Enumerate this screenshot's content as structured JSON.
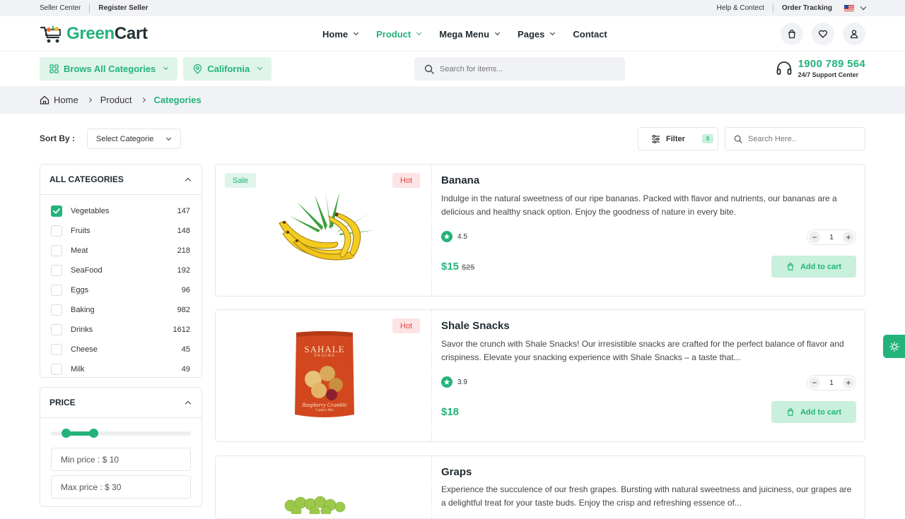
{
  "topbar": {
    "seller_center": "Seller Center",
    "register_seller": "Register Seller",
    "help_contact": "Help & Contect",
    "order_tracking": "Order Tracking",
    "language_flag": "us-flag-icon"
  },
  "brand": {
    "logo_green": "Green",
    "logo_dark": "Cart",
    "color": "#23b37a"
  },
  "nav": {
    "items": [
      {
        "label": "Home",
        "has_dropdown": true,
        "active": false
      },
      {
        "label": "Product",
        "has_dropdown": true,
        "active": true
      },
      {
        "label": "Mega Menu",
        "has_dropdown": true,
        "active": false
      },
      {
        "label": "Pages",
        "has_dropdown": true,
        "active": false
      },
      {
        "label": "Contact",
        "has_dropdown": false,
        "active": false
      }
    ]
  },
  "subbar": {
    "categories_btn": "Brows All Categories",
    "location_btn": "California",
    "search_placeholder": "Search for items...",
    "support_phone": "1900 789 564",
    "support_label": "24/7 Support Center"
  },
  "breadcrumb": {
    "items": [
      "Home",
      "Product",
      "Categories"
    ]
  },
  "toolbar": {
    "sort_label": "Sort By :",
    "sort_value": "Select Categorie",
    "filter_label": "Filter",
    "filter_count": "0",
    "search_placeholder": "Search Here.."
  },
  "sidebar": {
    "categories_title": "ALL CATEGORIES",
    "categories": [
      {
        "name": "Vegetables",
        "count": "147",
        "checked": true
      },
      {
        "name": "Fruits",
        "count": "148",
        "checked": false
      },
      {
        "name": "Meat",
        "count": "218",
        "checked": false
      },
      {
        "name": "SeaFood",
        "count": "192",
        "checked": false
      },
      {
        "name": "Eggs",
        "count": "96",
        "checked": false
      },
      {
        "name": "Baking",
        "count": "982",
        "checked": false
      },
      {
        "name": "Drinks",
        "count": "1612",
        "checked": false
      },
      {
        "name": "Cheese",
        "count": "45",
        "checked": false
      },
      {
        "name": "Milk",
        "count": "49",
        "checked": false
      }
    ],
    "price_title": "PRICE",
    "min_price": "Min price : $ 10",
    "max_price": "Max price : $ 30"
  },
  "products": [
    {
      "title": "Banana",
      "description": "Indulge in the natural sweetness of our ripe bananas. Packed with flavor and nutrients, our bananas are a delicious and healthy snack option. Enjoy the goodness of nature in every bite.",
      "rating": "4.5",
      "quantity": "1",
      "price": "$15",
      "old_price": "$25",
      "sale_tag": "Sale",
      "hot_tag": "Hot",
      "add_to_cart": "Add to cart"
    },
    {
      "title": "Shale Snacks",
      "description": "Savor the crunch with Shale Snacks! Our irresistible snacks are crafted for the perfect balance of flavor and crispiness. Elevate your snacking experience with Shale Snacks – a taste that...",
      "rating": "3.9",
      "quantity": "1",
      "price": "$18",
      "hot_tag": "Hot",
      "package_brand": "SAHALE",
      "package_sub": "SNACKS",
      "package_flavor": "Raspberry Crumble",
      "package_note": "Cashew Mix",
      "add_to_cart": "Add to cart"
    },
    {
      "title": "Graps",
      "description": "Experience the succulence of our fresh grapes. Bursting with natural sweetness and juiciness, our grapes are a delightful treat for your taste buds. Enjoy the crisp and refreshing essence of..."
    }
  ]
}
